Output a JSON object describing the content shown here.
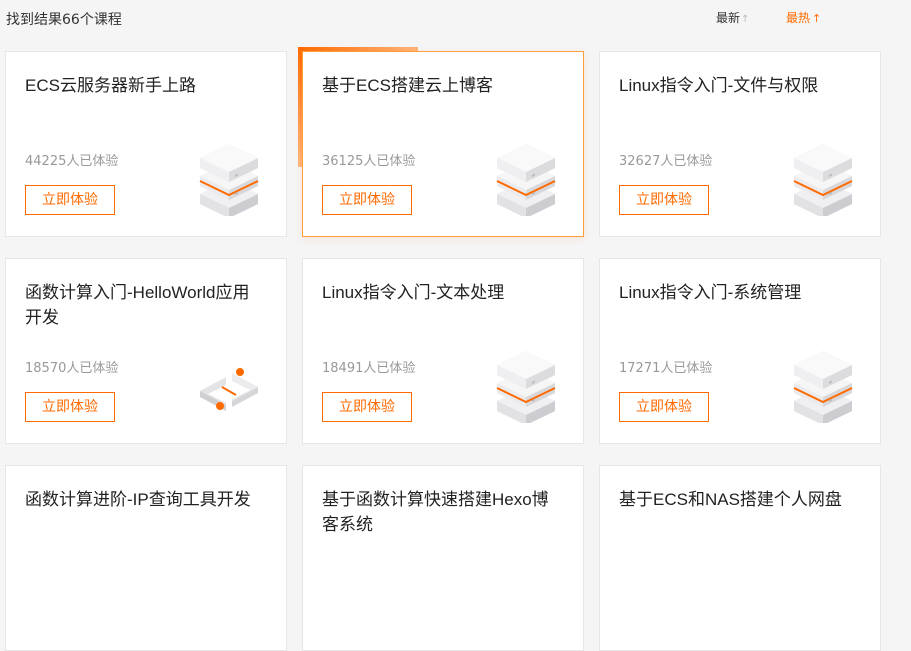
{
  "header": {
    "result_text": "找到结果66个课程",
    "sort_newest": "最新",
    "sort_newest_arrow": "↑",
    "sort_hot": "最热",
    "sort_hot_arrow": "↑"
  },
  "colors": {
    "accent": "#ff6a00"
  },
  "cards": [
    {
      "title": "ECS云服务器新手上路",
      "count": "44225人已体验",
      "button": "立即体验",
      "icon": "server-icon"
    },
    {
      "title": "基于ECS搭建云上博客",
      "count": "36125人已体验",
      "button": "立即体验",
      "icon": "server-icon"
    },
    {
      "title": "Linux指令入门-文件与权限",
      "count": "32627人已体验",
      "button": "立即体验",
      "icon": "server-icon"
    },
    {
      "title": "函数计算入门-HelloWorld应用开发",
      "count": "18570人已体验",
      "button": "立即体验",
      "icon": "function-compute-icon"
    },
    {
      "title": "Linux指令入门-文本处理",
      "count": "18491人已体验",
      "button": "立即体验",
      "icon": "server-icon"
    },
    {
      "title": "Linux指令入门-系统管理",
      "count": "17271人已体验",
      "button": "立即体验",
      "icon": "server-icon"
    },
    {
      "title": "函数计算进阶-IP查询工具开发",
      "count": "",
      "button": "",
      "icon": ""
    },
    {
      "title": "基于函数计算快速搭建Hexo博客系统",
      "count": "",
      "button": "",
      "icon": ""
    },
    {
      "title": "基于ECS和NAS搭建个人网盘",
      "count": "",
      "button": "",
      "icon": ""
    }
  ]
}
